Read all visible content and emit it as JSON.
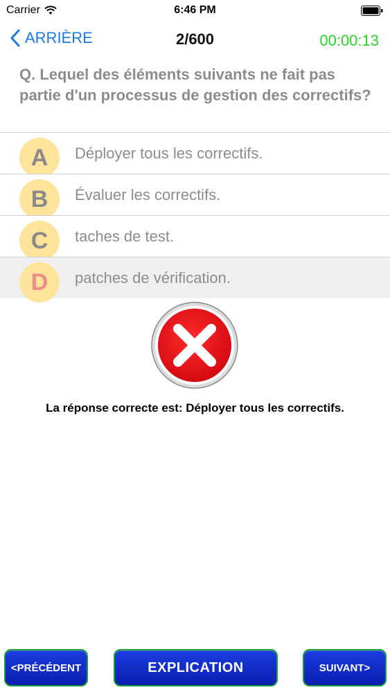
{
  "status_bar": {
    "carrier": "Carrier",
    "time": "6:46 PM"
  },
  "nav": {
    "back_label": "ARRIÈRE",
    "counter": "2/600",
    "timer": "00:00:13"
  },
  "question": {
    "text": "Q. Lequel des éléments suivants ne fait pas partie d'un processus de gestion des correctifs?"
  },
  "options": [
    {
      "letter": "A",
      "text": "Déployer tous les correctifs."
    },
    {
      "letter": "B",
      "text": "Évaluer les correctifs."
    },
    {
      "letter": "C",
      "text": "taches de test."
    },
    {
      "letter": "D",
      "text": "patches de vérification."
    }
  ],
  "selected_option": "D",
  "result": {
    "icon": "wrong-x-icon",
    "answer_text": "La réponse correcte est:  Déployer tous les correctifs."
  },
  "buttons": {
    "previous": "<PRÉCÉDENT",
    "explanation": "EXPLICATION",
    "next": "SUIVANT>"
  },
  "colors": {
    "accent_blue": "#1a7ae0",
    "timer_green": "#2bd02b",
    "badge_yellow": "#fde49a",
    "wrong_red": "#e8141e",
    "button_blue": "#1b3de0"
  }
}
